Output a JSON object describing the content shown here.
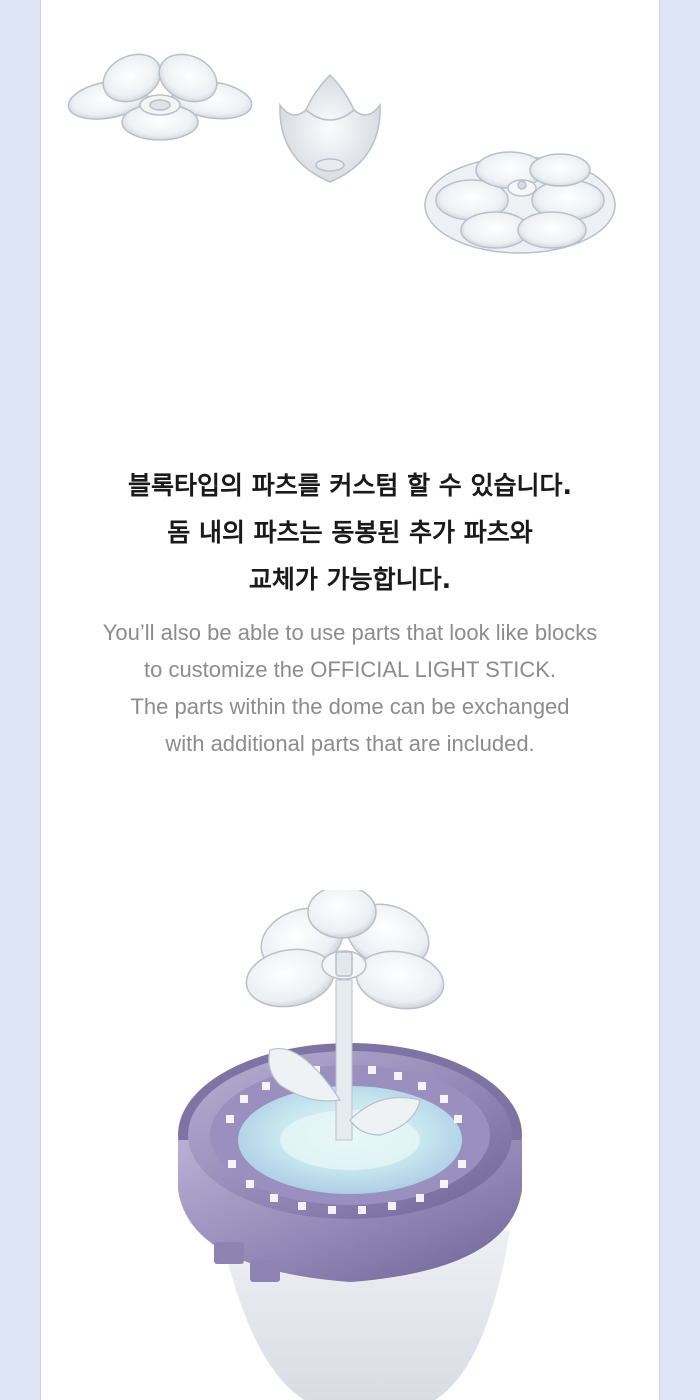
{
  "korean_lines": [
    "블록타입의 파츠를 커스텀 할 수 있습니다.",
    "돔 내의 파츠는 동봉된 추가 파츠와",
    "교체가 가능합니다."
  ],
  "english_lines": [
    "You’ll also be able to use parts that look like blocks",
    "to customize the OFFICIAL LIGHT STICK.",
    "The parts within the dome can be exchanged",
    "with additional parts that are included."
  ],
  "colors": {
    "page_background": "#dde4f6",
    "panel_background": "#ffffff",
    "heading_text": "#1a1a1a",
    "body_text": "#8c8c8c",
    "accent_purple": "#8e84b4"
  },
  "images": {
    "top": "clear-flower-block-parts",
    "bottom": "light-stick-dome-with-flower-part"
  }
}
